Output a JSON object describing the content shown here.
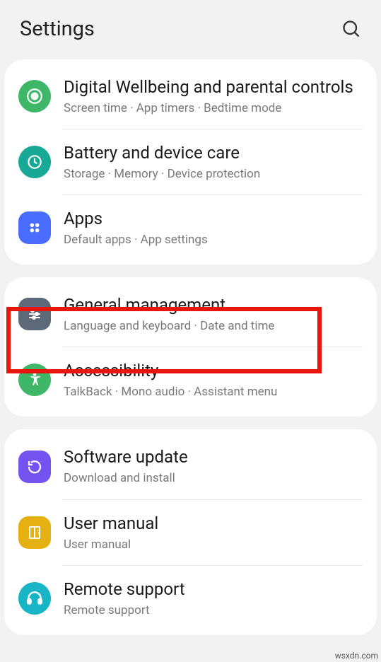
{
  "header": {
    "title": "Settings"
  },
  "groups": [
    {
      "items": [
        {
          "id": "digital-wellbeing",
          "icon": "heart-monitor",
          "color": "bg-green1",
          "title": "Digital Wellbeing and parental controls",
          "subtitle": "Screen time · App timers · Bedtime mode"
        },
        {
          "id": "battery-care",
          "icon": "battery-care",
          "color": "bg-teal",
          "title": "Battery and device care",
          "subtitle": "Storage · Memory · Device protection"
        },
        {
          "id": "apps",
          "icon": "apps-grid",
          "color": "bg-blue",
          "title": "Apps",
          "subtitle": "Default apps · App settings"
        }
      ]
    },
    {
      "items": [
        {
          "id": "general-management",
          "icon": "sliders",
          "color": "bg-slate",
          "title": "General management",
          "subtitle": "Language and keyboard · Date and time",
          "highlighted": true
        },
        {
          "id": "accessibility",
          "icon": "accessibility",
          "color": "bg-green2",
          "title": "Accessibility",
          "subtitle": "TalkBack · Mono audio · Assistant menu"
        }
      ]
    },
    {
      "items": [
        {
          "id": "software-update",
          "icon": "update",
          "color": "bg-purple",
          "title": "Software update",
          "subtitle": "Download and install"
        },
        {
          "id": "user-manual",
          "icon": "manual",
          "color": "bg-yellow",
          "title": "User manual",
          "subtitle": "User manual"
        },
        {
          "id": "remote-support",
          "icon": "headset",
          "color": "bg-cyan",
          "title": "Remote support",
          "subtitle": "Remote support"
        }
      ]
    }
  ],
  "watermark": "wsxdn.com"
}
